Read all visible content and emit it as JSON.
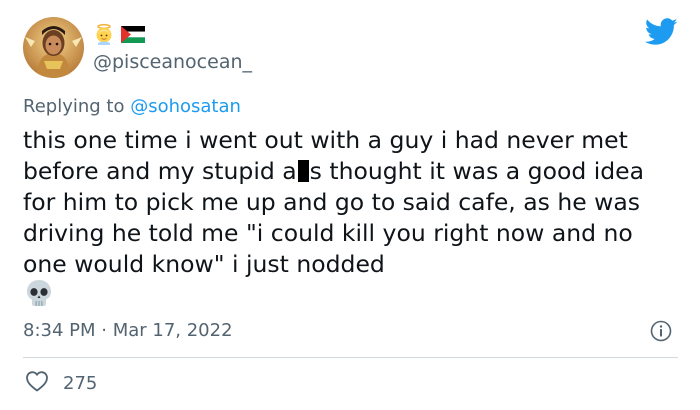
{
  "user": {
    "handle": "@pisceanocean_",
    "name_emojis": [
      "angel-emoji",
      "palestine-flag-emoji"
    ]
  },
  "reply": {
    "prefix": "Replying to ",
    "mention": "@sohosatan"
  },
  "tweet": {
    "text_before_censor": "this one time i went out with a guy i had never met before and my stupid a",
    "text_after_censor": "s thought it was a good idea for him to pick me up and go to said cafe, as he was driving he told me \"i could kill you right now and no one would know\" i just nodded",
    "trailing_emoji": "skull-emoji"
  },
  "meta": {
    "time": "8:34 PM",
    "separator": " · ",
    "date": "Mar 17, 2022"
  },
  "engagement": {
    "likes": "275"
  },
  "colors": {
    "twitter_blue": "#1d9bf0",
    "muted_text": "#536471",
    "main_text": "#0f1419",
    "divider": "#cfd9de"
  },
  "icons": {
    "brand": "twitter-bird-icon",
    "info": "info-icon",
    "like": "heart-icon"
  }
}
